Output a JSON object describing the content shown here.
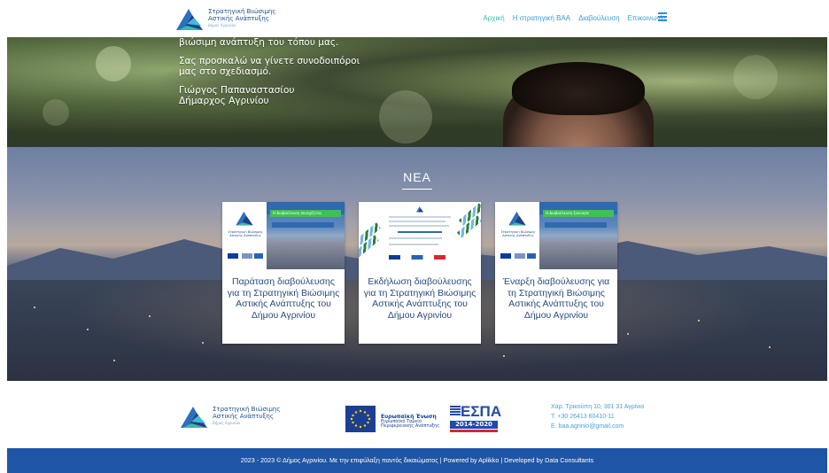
{
  "header": {
    "logo_title_1": "Στρατηγική Βιώσιμης",
    "logo_title_2": "Αστικής Ανάπτυξης",
    "logo_subtitle": "Δήμος Αγρινίου",
    "nav": [
      "Αρχική",
      "Η στρατηγική ΒΑΑ",
      "Διαβούλευση",
      "Επικοινωνία"
    ]
  },
  "hero": {
    "line1": "βιώσιμη ανάπτυξη του τόπου μας.",
    "line2a": "Σας προσκαλώ να γίνετε συνοδοιπόροι",
    "line2b": "μας στο σχεδιασμό.",
    "sign_name": "Γιώργος Παπαναστασίου",
    "sign_title": "Δήμαρχος Αγρινίου"
  },
  "news": {
    "title": "ΝΕΑ",
    "cards": [
      {
        "title": "Παράταση διαβούλευσης για τη Στρατηγική Βιώσιμης Αστικής Ανάπτυξης του Δήμου Αγρινίου",
        "img_banner": "Η Διαβούλευση συνεχίζεται"
      },
      {
        "title": "Εκδήλωση διαβούλευσης για τη Στρατηγική Βιώσιμης Αστικής Ανάπτυξης του Δήμου Αγρινίου",
        "img_banner": ""
      },
      {
        "title": "Έναρξη διαβούλευσης για τη Στρατηγική Βιώσιμης Αστικής Ανάπτυξης του Δήμου Αγρινίου",
        "img_banner": "Η Διαβούλευση ξεκίνησε"
      }
    ]
  },
  "footer": {
    "logo_title_1": "Στρατηγική Βιώσιμης",
    "logo_title_2": "Αστικής Ανάπτυξης",
    "logo_subtitle": "Δήμος Αγρινίου",
    "eu_title": "Ευρωπαϊκή Ένωση",
    "eu_line1": "Ευρωπαϊκό Ταμείο",
    "eu_line2": "Περιφερειακής Ανάπτυξης",
    "espa_title": "ΕΣΠΑ",
    "espa_years": "2014-2020",
    "address": "Χαρ. Τρικούπη 10, 301 31 Αγρίνιο",
    "phone": "T. +30 26413 60410-11",
    "email": "E. baa.agriniо@gmail.com"
  },
  "bottom_bar": "2023 - 2023 © Δήμος Αγρινίου. Με την επιφύλαξη παντός δικαιώματος | Powered by Aplikko | Developed by Data Consultants",
  "colors": {
    "brand_blue": "#1f55a5",
    "nav_blue": "#3c9bd6",
    "green": "#3fbf58"
  }
}
